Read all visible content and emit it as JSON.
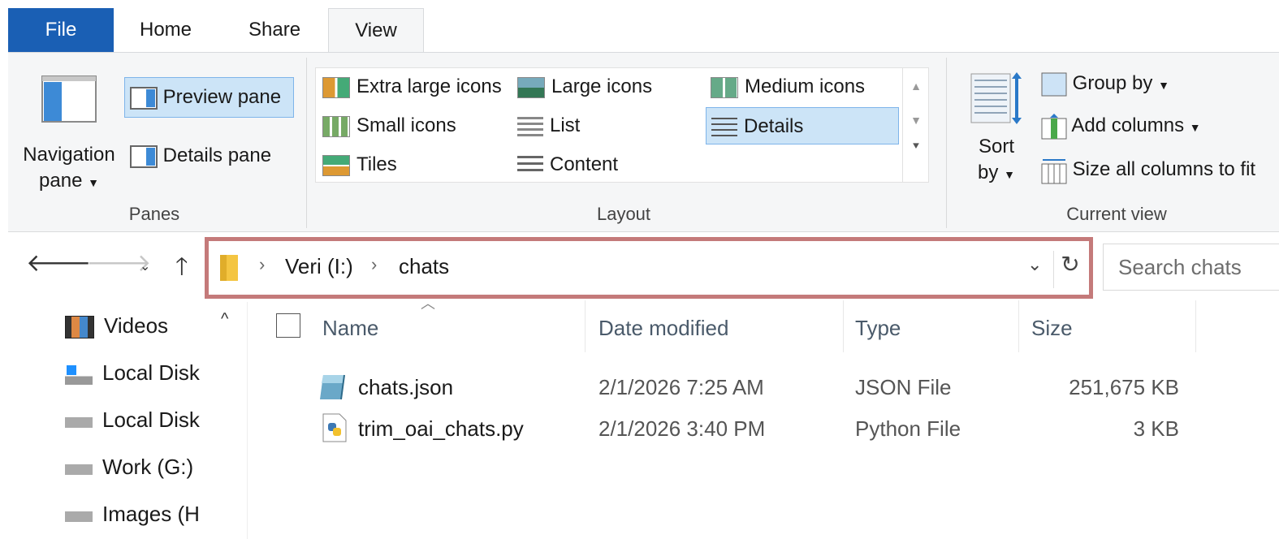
{
  "tabs": {
    "file": "File",
    "home": "Home",
    "share": "Share",
    "view": "View"
  },
  "ribbon": {
    "panes": {
      "navigation_pane_line1": "Navigation",
      "navigation_pane_line2": "pane",
      "preview_pane": "Preview pane",
      "details_pane": "Details pane",
      "group_label": "Panes"
    },
    "layout": {
      "items": [
        "Extra large icons",
        "Large icons",
        "Medium icons",
        "Small icons",
        "List",
        "Details",
        "Tiles",
        "Content"
      ],
      "selected": "Details",
      "group_label": "Layout"
    },
    "current_view": {
      "sort_line1": "Sort",
      "sort_line2": "by",
      "group_by": "Group by",
      "add_columns": "Add columns",
      "size_all_columns": "Size all columns to fit",
      "group_label": "Current view"
    }
  },
  "address": {
    "breadcrumb": [
      "Veri (I:)",
      "chats"
    ],
    "search_placeholder": "Search chats"
  },
  "sidebar": {
    "items": [
      {
        "label": "Videos",
        "icon": "videos-icon"
      },
      {
        "label": "Local Disk",
        "icon": "windows-drive-icon"
      },
      {
        "label": "Local Disk",
        "icon": "drive-icon"
      },
      {
        "label": "Work (G:)",
        "icon": "drive-icon"
      },
      {
        "label": "Images (H",
        "icon": "drive-icon"
      }
    ]
  },
  "columns": {
    "name": "Name",
    "date": "Date modified",
    "type": "Type",
    "size": "Size"
  },
  "files": [
    {
      "name": "chats.json",
      "date": "2/1/2026 7:25 AM",
      "type": "JSON File",
      "size": "251,675 KB",
      "icon": "json-file-icon"
    },
    {
      "name": "trim_oai_chats.py",
      "date": "2/1/2026 3:40 PM",
      "type": "Python File",
      "size": "3 KB",
      "icon": "python-file-icon"
    }
  ],
  "colors": {
    "file_tab": "#1a5fb4",
    "selection": "#cce4f7",
    "address_highlight": "#c47a7a"
  }
}
